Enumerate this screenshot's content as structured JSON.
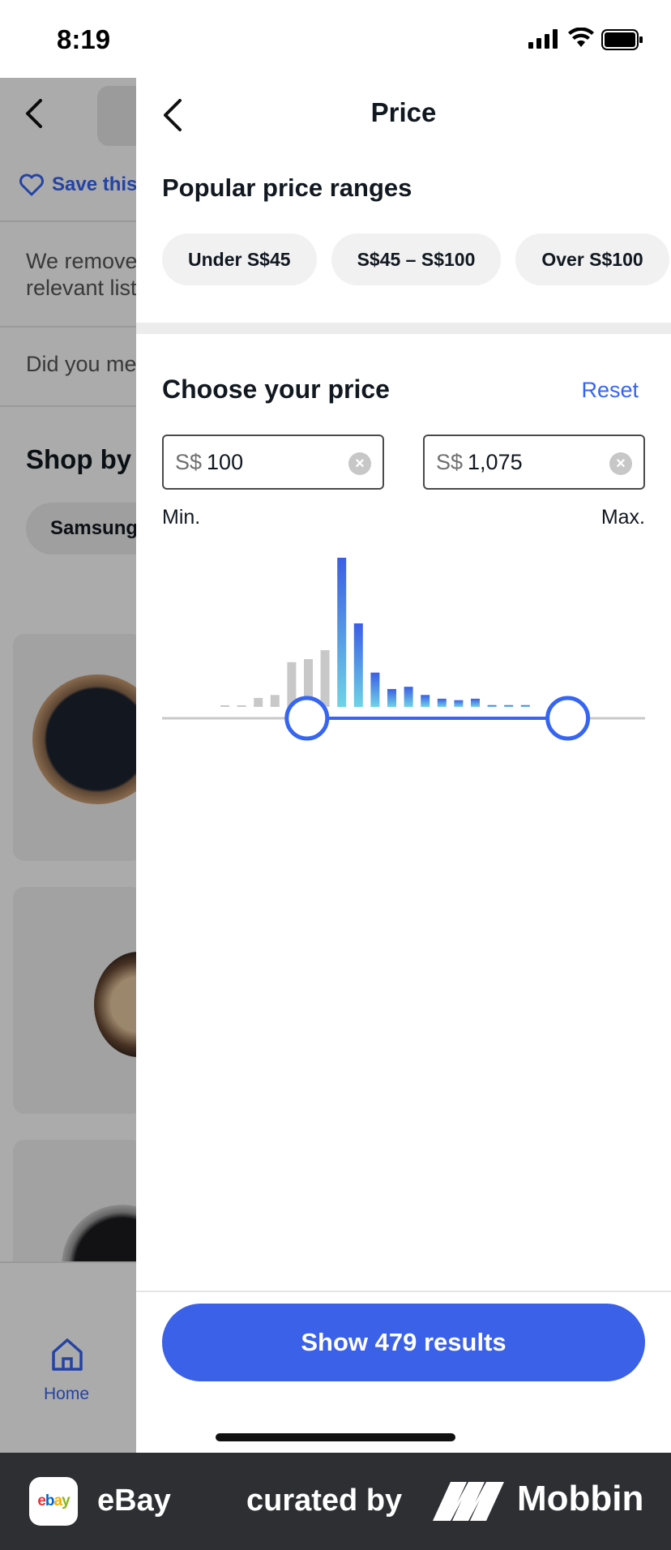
{
  "status_bar": {
    "time": "8:19"
  },
  "background_page": {
    "save_link": "Save this",
    "notice": "We removed some less relevant listings",
    "did_you_mean": "Did you mean",
    "shop_by": "Shop by",
    "chip": "Samsung",
    "tab_home": "Home"
  },
  "panel": {
    "title": "Price",
    "popular_title": "Popular price ranges",
    "popular_chips": [
      "Under S$45",
      "S$45 – S$100",
      "Over S$100"
    ],
    "choose_title": "Choose your price",
    "reset_label": "Reset",
    "currency": "S$",
    "min_value": "100",
    "max_value": "1,075",
    "min_label": "Min.",
    "max_label": "Max.",
    "cta_label": "Show 479 results"
  },
  "histogram": {
    "bar_heights": [
      0.008,
      0.008,
      0.06,
      0.08,
      0.3,
      0.32,
      0.38,
      1.0,
      0.56,
      0.23,
      0.12,
      0.135,
      0.08,
      0.055,
      0.045,
      0.055,
      0.012,
      0.012,
      0.012
    ],
    "selected_range": [
      0.3,
      0.84
    ],
    "selected_bar_range": [
      7,
      18
    ]
  },
  "colors": {
    "accent": "#3665f3",
    "cta": "#3b61e8",
    "selected_top": "#3b5ee3",
    "selected_bottom": "#6fd3e6",
    "unselected_bar": "#c8c8c8"
  },
  "brand_bar": {
    "app_logo": "ebay",
    "app_name": "eBay",
    "curated_by": "curated by",
    "mobbin": "Mobbin"
  }
}
